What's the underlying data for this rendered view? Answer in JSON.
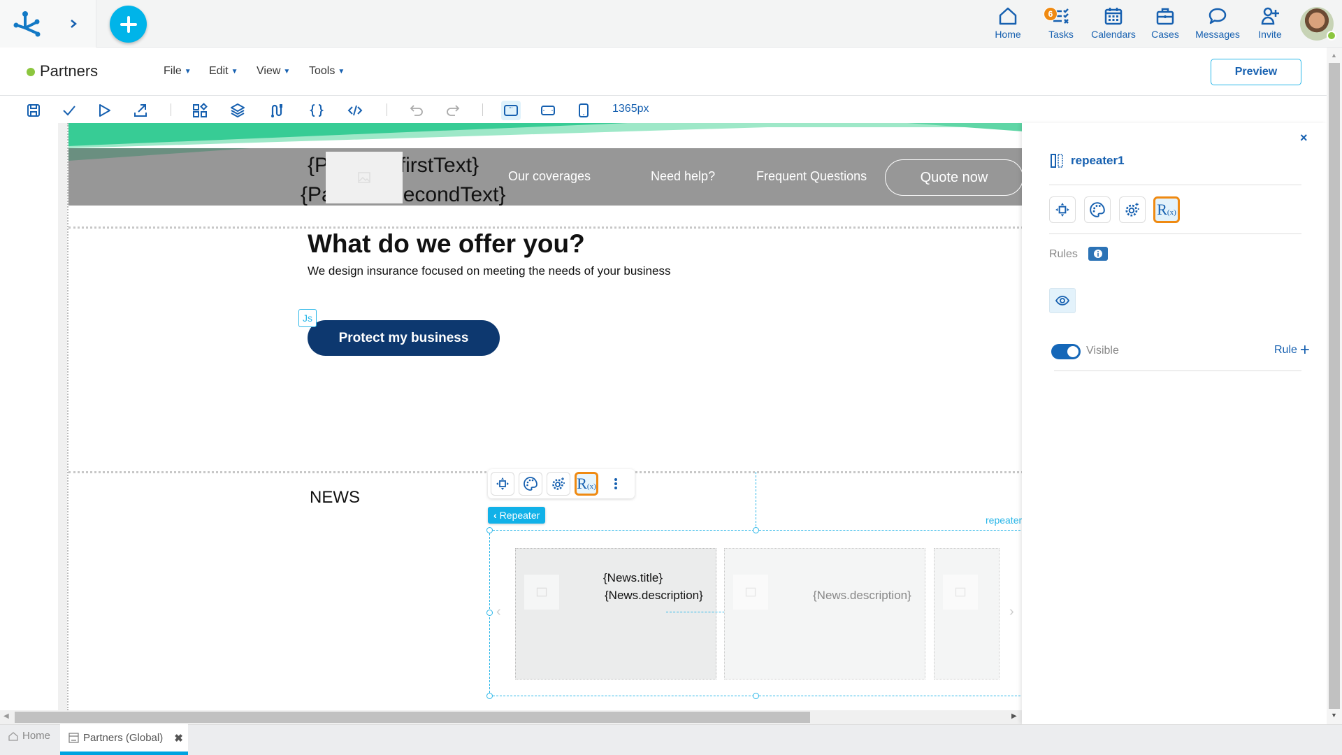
{
  "topbar": {
    "nav": [
      {
        "label": "Home",
        "icon": "home-icon"
      },
      {
        "label": "Tasks",
        "icon": "tasks-icon",
        "badge": "6"
      },
      {
        "label": "Calendars",
        "icon": "calendar-icon"
      },
      {
        "label": "Cases",
        "icon": "briefcase-icon"
      },
      {
        "label": "Messages",
        "icon": "chat-icon"
      },
      {
        "label": "Invite",
        "icon": "user-plus-icon"
      }
    ],
    "add_symbol": "+"
  },
  "titlebar": {
    "title": "Partners",
    "menus": [
      "File",
      "Edit",
      "View",
      "Tools"
    ],
    "preview_label": "Preview"
  },
  "toolbar": {
    "width_label": "1365px"
  },
  "canvas": {
    "hero": {
      "first_text": "{Partners.firstText}",
      "second_text": "{Partners.secondText}",
      "links": [
        "Our coverages",
        "Need help?",
        "Frequent Questions"
      ],
      "quote_label": "Quote now"
    },
    "offer": {
      "title": "What do we offer you?",
      "subtitle": "We design insurance focused on meeting the needs of your business",
      "js_badge": "Js",
      "cta_label": "Protect my business"
    },
    "news": {
      "title": "NEWS",
      "repeater_tag": "Repeater",
      "repeater_name": "repeater1",
      "cards": [
        {
          "title": "{News.title}",
          "description": "{News.description}"
        },
        {
          "title": "",
          "description": "{News.description}"
        },
        {
          "title": "",
          "description": ""
        }
      ]
    }
  },
  "panel": {
    "component_name": "repeater1",
    "rules_label": "Rules",
    "visible_label": "Visible",
    "visible_on": true,
    "rule_add_label": "Rule",
    "close_symbol": "×"
  },
  "tabs": {
    "home_label": "Home",
    "active_label": "Partners (Global)"
  },
  "colors": {
    "accent": "#00b4e9",
    "primary": "#1660b0",
    "highlight": "#ef8a12",
    "status_ok": "#8cc63f",
    "cta": "#0d386f"
  }
}
